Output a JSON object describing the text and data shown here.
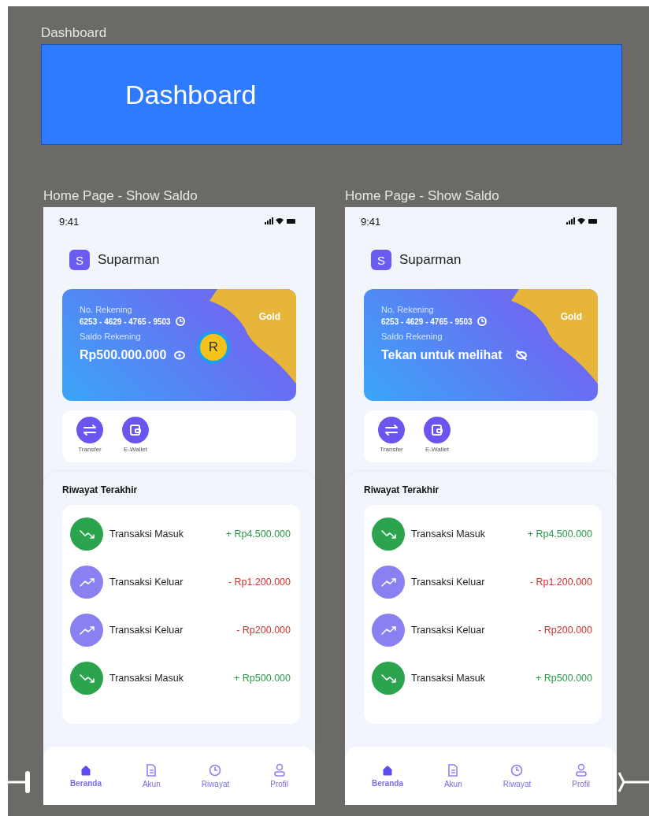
{
  "section": {
    "label": "Dashboard",
    "banner_title": "Dashboard"
  },
  "frames": [
    {
      "label": "Home Page - Show Saldo",
      "time": "9:41",
      "user": {
        "initial": "S",
        "name": "Suparman"
      },
      "card": {
        "account_label": "No. Rekening",
        "account_number": "6253 - 4629 - 4765 - 9503",
        "balance_label": "Saldo Rekening",
        "balance": "Rp500.000.000",
        "balance_visible": true,
        "tier": "Gold"
      },
      "cursor": {
        "initial": "R"
      },
      "actions": [
        {
          "kind": "transfer",
          "label": "Transfer"
        },
        {
          "kind": "wallet",
          "label": "E-Wallet"
        }
      ],
      "history": {
        "title": "Riwayat Terakhir",
        "items": [
          {
            "kind": "in",
            "label": "Transaksi Masuk",
            "amount": "+ Rp4.500.000"
          },
          {
            "kind": "out",
            "label": "Transaksi Keluar",
            "amount": "- Rp1.200.000"
          },
          {
            "kind": "out",
            "label": "Transaksi Keluar",
            "amount": "- Rp200.000"
          },
          {
            "kind": "in",
            "label": "Transaksi Masuk",
            "amount": "+ Rp500.000"
          }
        ]
      },
      "nav": [
        {
          "kind": "home",
          "label": "Beranda",
          "selected": true
        },
        {
          "kind": "doc",
          "label": "Akun",
          "selected": false
        },
        {
          "kind": "clock",
          "label": "Riwayat",
          "selected": false
        },
        {
          "kind": "user",
          "label": "Profil",
          "selected": false
        }
      ]
    },
    {
      "label": "Home Page - Show Saldo",
      "time": "9:41",
      "user": {
        "initial": "S",
        "name": "Suparman"
      },
      "card": {
        "account_label": "No. Rekening",
        "account_number": "6253 - 4629 - 4765 - 9503",
        "balance_label": "Saldo Rekening",
        "balance": "Tekan untuk melihat",
        "balance_visible": false,
        "tier": "Gold"
      },
      "actions": [
        {
          "kind": "transfer",
          "label": "Transfer"
        },
        {
          "kind": "wallet",
          "label": "E-Wallet"
        }
      ],
      "history": {
        "title": "Riwayat Terakhir",
        "items": [
          {
            "kind": "in",
            "label": "Transaksi Masuk",
            "amount": "+ Rp4.500.000"
          },
          {
            "kind": "out",
            "label": "Transaksi Keluar",
            "amount": "- Rp1.200.000"
          },
          {
            "kind": "out",
            "label": "Transaksi Keluar",
            "amount": "- Rp200.000"
          },
          {
            "kind": "in",
            "label": "Transaksi Masuk",
            "amount": "+ Rp500.000"
          }
        ]
      },
      "nav": [
        {
          "kind": "home",
          "label": "Beranda",
          "selected": true
        },
        {
          "kind": "doc",
          "label": "Akun",
          "selected": false
        },
        {
          "kind": "clock",
          "label": "Riwayat",
          "selected": false
        },
        {
          "kind": "user",
          "label": "Profil",
          "selected": false
        }
      ]
    }
  ]
}
